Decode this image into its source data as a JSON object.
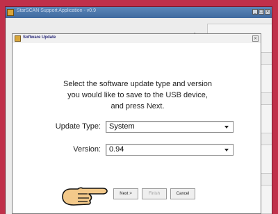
{
  "app_window": {
    "title": "StarSCAN Support Application - v0.9",
    "minimize": "_",
    "maximize": "□",
    "close": "×",
    "decorative_text": "/"
  },
  "dialog": {
    "title": "Software Update",
    "close": "×",
    "instruction": "Select the software update type and version you would like to save to the USB device, and press Next.",
    "update_type_label": "Update Type:",
    "update_type_value": "System",
    "version_label": "Version:",
    "version_value": "0.94",
    "buttons": {
      "next": "Next >",
      "finish": "Finish",
      "cancel": "Cancel"
    }
  },
  "colors": {
    "background": "#c0304a",
    "titlebar": "#4a76ab",
    "pointer_hand": "#f3c98a"
  },
  "icons": [
    "app-icon",
    "dialog-icon",
    "pointing-hand-icon",
    "dropdown-arrow-icon"
  ]
}
